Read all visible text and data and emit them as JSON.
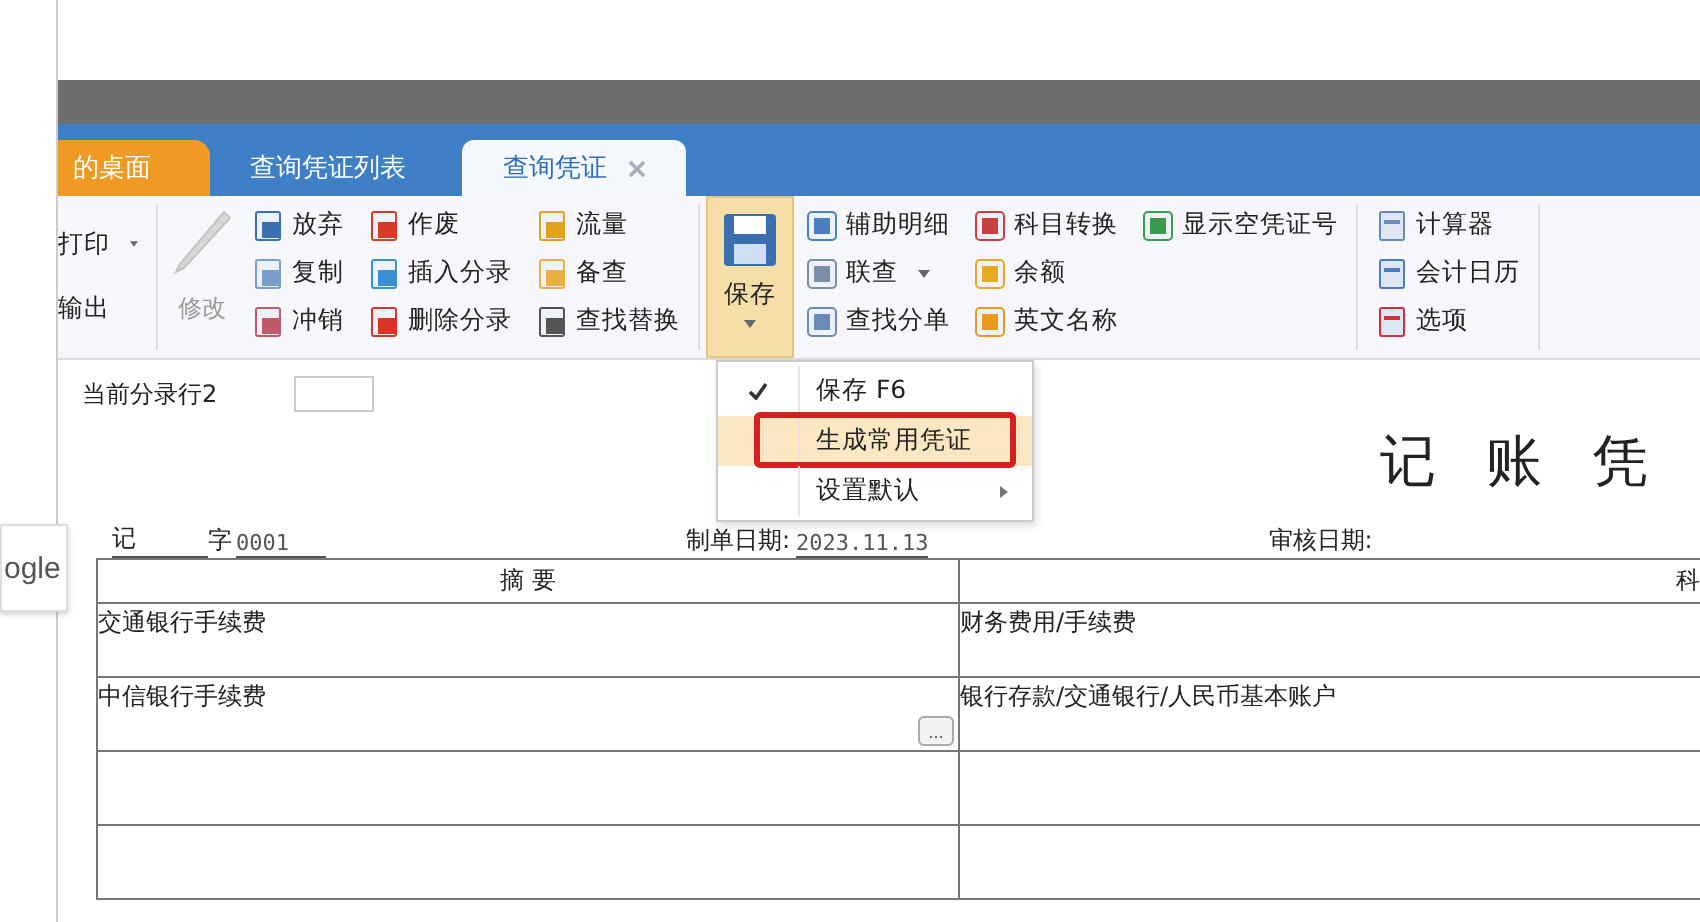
{
  "background_window": {
    "text": "ogle"
  },
  "tabs": [
    {
      "label": "的桌面",
      "kind": "home",
      "selected": false,
      "closable": false
    },
    {
      "label": "查询凭证列表",
      "kind": "plain",
      "selected": false,
      "closable": false
    },
    {
      "label": "查询凭证",
      "kind": "plain",
      "selected": true,
      "closable": true
    }
  ],
  "ribbon": {
    "output_group": [
      {
        "label": "打印",
        "dropdown": true
      },
      {
        "label": "输出",
        "dropdown": false
      }
    ],
    "edit_button": {
      "label": "修改",
      "disabled": true
    },
    "columns_1": [
      [
        {
          "label": "放弃",
          "dropdown": false
        },
        {
          "label": "复制",
          "dropdown": false
        },
        {
          "label": "冲销",
          "dropdown": false
        }
      ],
      [
        {
          "label": "作废",
          "dropdown": false
        },
        {
          "label": "插入分录",
          "dropdown": false
        },
        {
          "label": "删除分录",
          "dropdown": false
        }
      ],
      [
        {
          "label": "流量",
          "dropdown": false
        },
        {
          "label": "备查",
          "dropdown": false
        },
        {
          "label": "查找替换",
          "dropdown": false
        }
      ]
    ],
    "save_button": {
      "label": "保存",
      "expanded": true
    },
    "columns_2": [
      [
        {
          "label": "辅助明细",
          "dropdown": false
        },
        {
          "label": "联查",
          "dropdown": true
        },
        {
          "label": "查找分单",
          "dropdown": false
        }
      ],
      [
        {
          "label": "科目转换",
          "dropdown": false
        },
        {
          "label": "余额",
          "dropdown": false
        },
        {
          "label": "英文名称",
          "dropdown": false
        }
      ],
      [
        {
          "label": "显示空凭证号",
          "dropdown": false
        }
      ]
    ],
    "tools": [
      {
        "label": "计算器",
        "dropdown": false
      },
      {
        "label": "会计日历",
        "dropdown": false
      },
      {
        "label": "选项",
        "dropdown": false
      }
    ]
  },
  "save_menu": [
    {
      "label": "保存 F6",
      "checked": true,
      "selected": false,
      "outlined": false,
      "submenu": false
    },
    {
      "label": "生成常用凭证",
      "checked": false,
      "selected": true,
      "outlined": true,
      "submenu": false
    },
    {
      "label": "设置默认",
      "checked": false,
      "selected": false,
      "outlined": false,
      "submenu": true
    }
  ],
  "current_row": {
    "label": "当前分录行2"
  },
  "voucher": {
    "title": "记 账 凭",
    "type": "记",
    "word_label": "字",
    "number": "0001",
    "made_date_label": "制单日期:",
    "made_date": "2023.11.13",
    "review_date_label": "审核日期:",
    "columns": [
      "摘 要",
      "科"
    ],
    "rows": [
      {
        "summary": "交通银行手续费",
        "account": "财务费用/手续费",
        "more_button": ""
      },
      {
        "summary": "中信银行手续费",
        "account": "银行存款/交通银行/人民币基本账户",
        "more_button": "..."
      },
      {
        "summary": "",
        "account": "",
        "more_button": ""
      },
      {
        "summary": "",
        "account": "",
        "more_button": ""
      }
    ]
  }
}
